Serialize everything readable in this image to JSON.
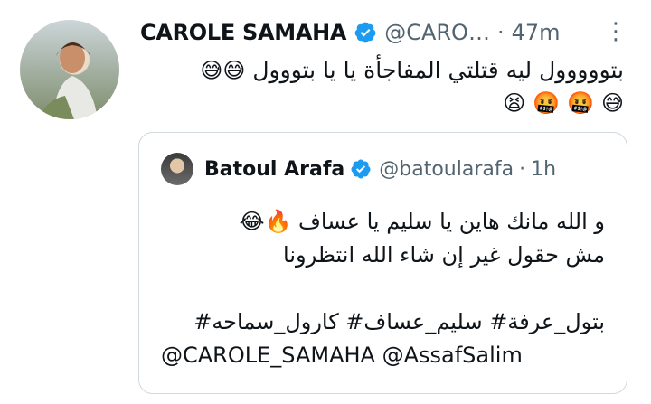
{
  "tweet": {
    "author_name": "CAROLE SAMAHA",
    "author_handle": "@CARO…",
    "separator": "·",
    "time": "47m",
    "more_icon": "⋮",
    "text": "بتووووول ليه قتلتي المفاجأة يا يا بتووول",
    "emojis_line1": [
      "😅",
      "😅"
    ],
    "emojis_line2": [
      "😅",
      "🤬",
      "🤬",
      "😫"
    ]
  },
  "quoted_tweet": {
    "author_name": "Batoul Arafa",
    "author_handle": "@batoularafa",
    "separator": "·",
    "time": "1h",
    "line1": "و الله مانك هاين يا سليم يا عساف",
    "line1_emojis": [
      "🔥",
      "😂"
    ],
    "line2": "مش حقول غير إن شاء الله انتظرونا",
    "hashtags": "بتول_عرفة# سليم_عساف# كارول_سماحه#",
    "mentions": "@CAROLE_SAMAHA @AssafSalim"
  },
  "colors": {
    "verified_blue": "#1d9bf0",
    "secondary_text": "#536471",
    "border": "#cfd9de"
  }
}
